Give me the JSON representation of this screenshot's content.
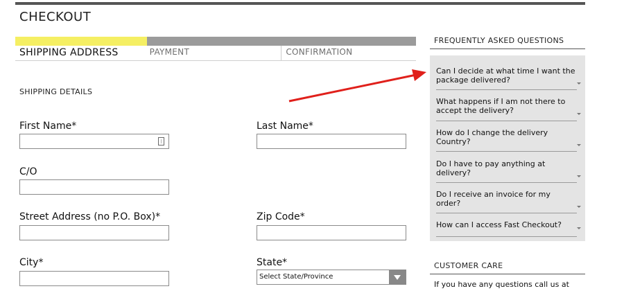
{
  "page": {
    "title": "CHECKOUT"
  },
  "steps": [
    {
      "label": "SHIPPING ADDRESS",
      "active": true
    },
    {
      "label": "PAYMENT",
      "active": false
    },
    {
      "label": "CONFIRMATION",
      "active": false
    }
  ],
  "colors": {
    "active_step": "#f5ef63",
    "inactive_step": "#9b9b9b",
    "faq_bg": "#e4e4e4",
    "arrow": "#e0201b"
  },
  "form": {
    "section_title": "SHIPPING DETAILS",
    "first_name": {
      "label": "First Name*",
      "value": ""
    },
    "last_name": {
      "label": "Last Name*",
      "value": ""
    },
    "co": {
      "label": "C/O",
      "value": ""
    },
    "street": {
      "label": "Street Address (no P.O. Box)*",
      "value": ""
    },
    "zip": {
      "label": "Zip Code*",
      "value": ""
    },
    "city": {
      "label": "City*",
      "value": ""
    },
    "state": {
      "label": "State*",
      "selected": "Select State/Province"
    }
  },
  "faq": {
    "title": "FREQUENTLY ASKED QUESTIONS",
    "items": [
      "Can I decide at what time I want the package delivered?",
      "What happens if I am not there to accept the delivery?",
      "How do I change the delivery Country?",
      "Do I have to pay anything at delivery?",
      "Do I receive an invoice for my order?",
      "How can I access Fast Checkout?"
    ]
  },
  "customer_care": {
    "title": "CUSTOMER CARE",
    "text": "If you have any questions call us at"
  }
}
